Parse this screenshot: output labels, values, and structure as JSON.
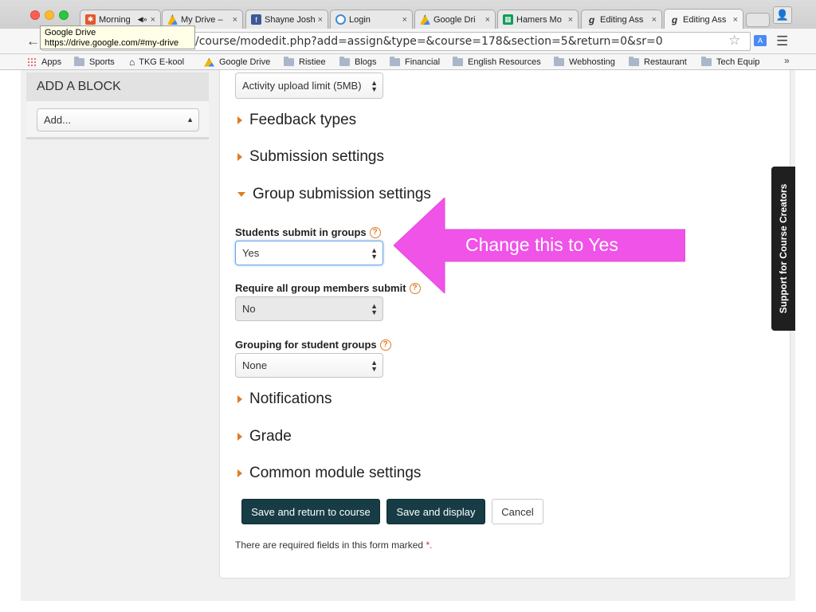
{
  "browser": {
    "tabs": [
      {
        "title": "Morning",
        "icon": "nbc-icon",
        "color": "#e2572b",
        "extra": "◀»"
      },
      {
        "title": "My Drive –",
        "icon": "google-drive-icon",
        "color": "#f4b400"
      },
      {
        "title": "Shayne Josh",
        "icon": "facebook-icon",
        "color": "#3b5998"
      },
      {
        "title": "Login",
        "icon": "login-icon",
        "color": "#3c8dd8"
      },
      {
        "title": "Google Dri",
        "icon": "google-drive-icon",
        "color": "#f4b400"
      },
      {
        "title": "Hamers Mo",
        "icon": "sheets-icon",
        "color": "#0f9d58"
      },
      {
        "title": "Editing Ass",
        "icon": "moodle-icon",
        "color": "#333333"
      },
      {
        "title": "Editing Ass",
        "icon": "moodle-icon",
        "color": "#333333"
      }
    ],
    "url": "/course/modedit.php?add=assign&type=&course=178&section=5&return=0&sr=0",
    "tooltip": {
      "title": "Google Drive",
      "url": "https://drive.google.com/#my-drive"
    },
    "bookmarks": [
      "Apps",
      "Sports",
      "TKG E-kool",
      "Google Drive",
      "Ristiee",
      "Blogs",
      "Financial",
      "English Resources",
      "Webhosting",
      "Restaurant",
      "Tech Equip"
    ]
  },
  "sidebar": {
    "block_title": "ADD A BLOCK",
    "block_select": "Add..."
  },
  "form": {
    "upload_limit": "Activity upload limit (5MB)",
    "sections": {
      "feedback": "Feedback types",
      "submission": "Submission settings",
      "group": "Group submission settings",
      "notifications": "Notifications",
      "grade": "Grade",
      "common": "Common module settings"
    },
    "fields": {
      "students_submit_label": "Students submit in groups",
      "students_submit_value": "Yes",
      "require_all_label": "Require all group members submit",
      "require_all_value": "No",
      "grouping_label": "Grouping for student groups",
      "grouping_value": "None"
    },
    "buttons": {
      "save_return": "Save and return to course",
      "save_display": "Save and display",
      "cancel": "Cancel"
    },
    "required_note": "There are required fields in this form marked",
    "required_star": "*."
  },
  "annotation": {
    "text": "Change this to Yes",
    "color": "#f053e8"
  },
  "support_tab": "Support for Course Creators",
  "colors": {
    "accent": "#e07b20",
    "button_dark": "#173c45",
    "required": "#d9262c"
  }
}
